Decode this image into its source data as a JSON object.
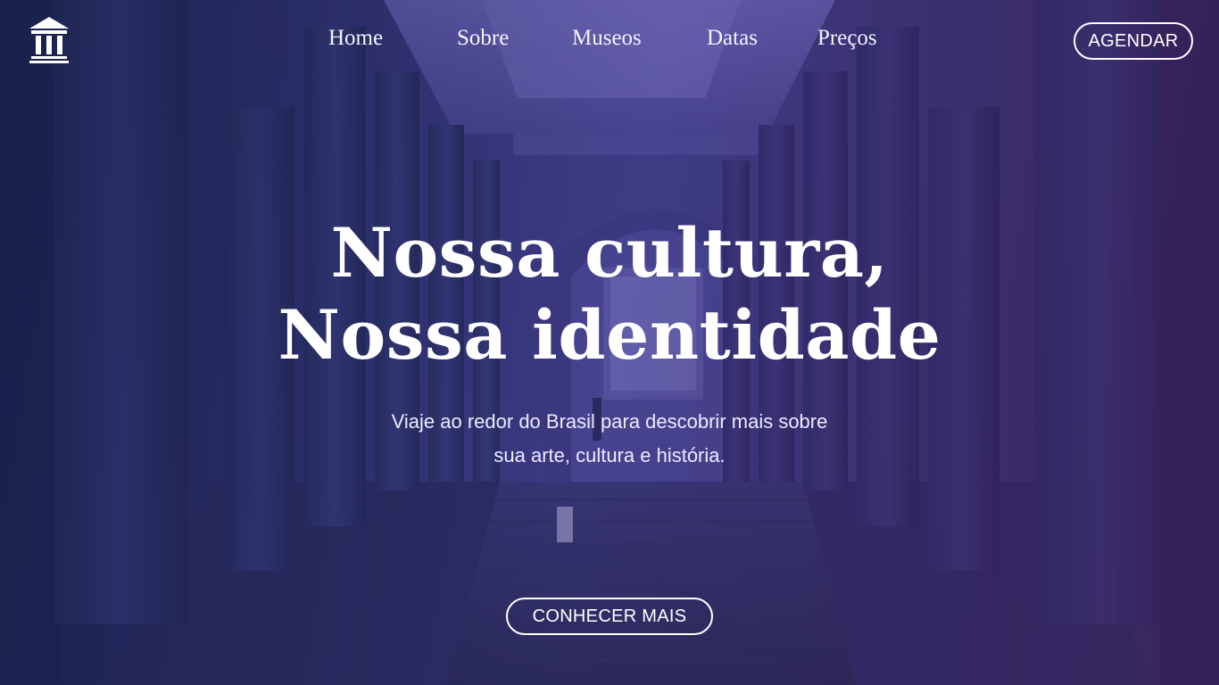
{
  "nav": {
    "items": [
      {
        "label": "Home"
      },
      {
        "label": "Sobre"
      },
      {
        "label": "Museos"
      },
      {
        "label": "Datas"
      },
      {
        "label": "Preços"
      }
    ],
    "cta_label": "AGENDAR"
  },
  "hero": {
    "headline_line1": "Nossa cultura,",
    "headline_line2": "Nossa identidade",
    "subtitle_line1": "Viaje ao redor do Brasil para descobrir mais sobre",
    "subtitle_line2": "sua arte, cultura e história.",
    "cta_label": "CONHECER MAIS"
  },
  "icons": {
    "logo": "museum-columns-icon"
  },
  "colors": {
    "overlay_left": "#1b2350",
    "overlay_center": "#4a4690",
    "overlay_right": "#3a2a62",
    "text": "#ffffff"
  }
}
